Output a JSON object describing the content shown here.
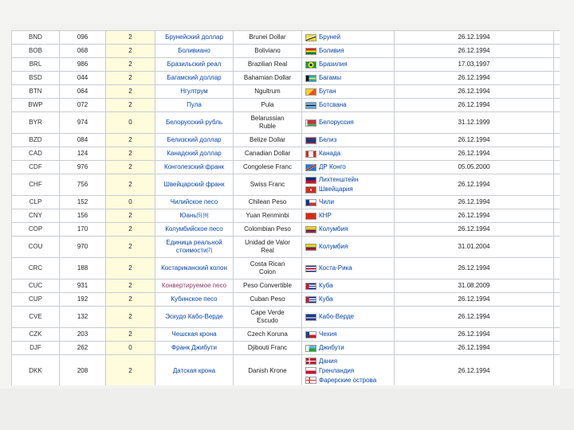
{
  "rows": [
    {
      "code": "BND",
      "num": "096",
      "digits": "2",
      "local": "Брунейский доллар",
      "eng": [
        "Brunei Dollar"
      ],
      "countries": [
        {
          "name": "Бруней",
          "flag": "bn"
        }
      ],
      "date": "26.12.1994"
    },
    {
      "code": "BOB",
      "num": "068",
      "digits": "2",
      "local": "Боливиано",
      "eng": [
        "Boliviano"
      ],
      "countries": [
        {
          "name": "Боливия",
          "flag": "bo"
        }
      ],
      "date": "26.12.1994"
    },
    {
      "code": "BRL",
      "num": "986",
      "digits": "2",
      "local": "Бразильский реал",
      "eng": [
        "Brazilian Real"
      ],
      "countries": [
        {
          "name": "Бразилия",
          "flag": "br"
        }
      ],
      "date": "17.03.1997"
    },
    {
      "code": "BSD",
      "num": "044",
      "digits": "2",
      "local": "Багамский доллар",
      "eng": [
        "Bahamian Dollar"
      ],
      "countries": [
        {
          "name": "Багамы",
          "flag": "bs"
        }
      ],
      "date": "26.12.1994"
    },
    {
      "code": "BTN",
      "num": "064",
      "digits": "2",
      "local": "Нгултрум",
      "eng": [
        "Ngultrum"
      ],
      "countries": [
        {
          "name": "Бутан",
          "flag": "bt"
        }
      ],
      "date": "26.12.1994"
    },
    {
      "code": "BWP",
      "num": "072",
      "digits": "2",
      "local": "Пула",
      "eng": [
        "Pula"
      ],
      "countries": [
        {
          "name": "Ботсвана",
          "flag": "bw"
        }
      ],
      "date": "26.12.1994"
    },
    {
      "code": "BYR",
      "num": "974",
      "digits": "0",
      "local": "Белорусский рубль",
      "eng": [
        "Belarussian",
        "Ruble"
      ],
      "countries": [
        {
          "name": "Белоруссия",
          "flag": "by"
        }
      ],
      "date": "31.12.1999",
      "h": "tall"
    },
    {
      "code": "BZD",
      "num": "084",
      "digits": "2",
      "local": "Белизский доллар",
      "eng": [
        "Belize Dollar"
      ],
      "countries": [
        {
          "name": "Белиз",
          "flag": "bz"
        }
      ],
      "date": "26.12.1994"
    },
    {
      "code": "CAD",
      "num": "124",
      "digits": "2",
      "local": "Канадский доллар",
      "eng": [
        "Canadian Dollar"
      ],
      "countries": [
        {
          "name": "Канада",
          "flag": "ca"
        }
      ],
      "date": "26.12.1994"
    },
    {
      "code": "CDF",
      "num": "976",
      "digits": "2",
      "local": "Конголезский франк",
      "eng": [
        "Congolese Franc"
      ],
      "countries": [
        {
          "name": "ДР Конго",
          "flag": "cd"
        }
      ],
      "date": "05.05.2000"
    },
    {
      "code": "CHF",
      "num": "756",
      "digits": "2",
      "local": "Швейцарский франк",
      "eng": [
        "Swiss Franc"
      ],
      "countries": [
        {
          "name": "Лихтенштейн",
          "flag": "li"
        },
        {
          "name": "Швейцария",
          "flag": "ch"
        }
      ],
      "date": "26.12.1994",
      "h": "tall"
    },
    {
      "code": "CLP",
      "num": "152",
      "digits": "0",
      "local": "Чилийское песо",
      "eng": [
        "Chilean Peso"
      ],
      "countries": [
        {
          "name": "Чили",
          "flag": "cl"
        }
      ],
      "date": "26.12.1994"
    },
    {
      "code": "CNY",
      "num": "156",
      "digits": "2",
      "local": "Юань",
      "sup": "[5] [6]",
      "eng": [
        "Yuan Renminbi"
      ],
      "countries": [
        {
          "name": "КНР",
          "flag": "cn"
        }
      ],
      "date": "26.12.1994"
    },
    {
      "code": "COP",
      "num": "170",
      "digits": "2",
      "local": "Колумбийское песо",
      "eng": [
        "Colombian Peso"
      ],
      "countries": [
        {
          "name": "Колумбия",
          "flag": "co"
        }
      ],
      "date": "26.12.1994"
    },
    {
      "code": "COU",
      "num": "970",
      "digits": "2",
      "local": "Единица реальной стоимости",
      "sup": "[7]",
      "eng": [
        "Unidad de Valor",
        "Real"
      ],
      "countries": [
        {
          "name": "Колумбия",
          "flag": "co"
        }
      ],
      "date": "31.01.2004",
      "h": "tall"
    },
    {
      "code": "CRC",
      "num": "188",
      "digits": "2",
      "local": "Костариканский колон",
      "eng": [
        "Costa Rican",
        "Colon"
      ],
      "countries": [
        {
          "name": "Коста-Рика",
          "flag": "cr"
        }
      ],
      "date": "26.12.1994",
      "h": "tall"
    },
    {
      "code": "CUC",
      "num": "931",
      "digits": "2",
      "local": "Конвертируемое песо",
      "visited": true,
      "eng": [
        "Peso Convertible"
      ],
      "countries": [
        {
          "name": "Куба",
          "flag": "cu"
        }
      ],
      "date": "31.08.2009"
    },
    {
      "code": "CUP",
      "num": "192",
      "digits": "2",
      "local": "Кубинское песо",
      "eng": [
        "Cuban Peso"
      ],
      "countries": [
        {
          "name": "Куба",
          "flag": "cu"
        }
      ],
      "date": "26.12.1994"
    },
    {
      "code": "CVE",
      "num": "132",
      "digits": "2",
      "local": "Эскудо Кабо-Верде",
      "eng": [
        "Cape Verde",
        "Escudo"
      ],
      "countries": [
        {
          "name": "Кабо-Верде",
          "flag": "cv"
        }
      ],
      "date": "26.12.1994",
      "h": "tall"
    },
    {
      "code": "CZK",
      "num": "203",
      "digits": "2",
      "local": "Чешская крона",
      "eng": [
        "Czech Koruna"
      ],
      "countries": [
        {
          "name": "Чехия",
          "flag": "cz"
        }
      ],
      "date": "26.12.1994"
    },
    {
      "code": "DJF",
      "num": "262",
      "digits": "0",
      "local": "Франк Джибути",
      "eng": [
        "Djibouti Franc"
      ],
      "countries": [
        {
          "name": "Джибути",
          "flag": "dj"
        }
      ],
      "date": "26.12.1994"
    },
    {
      "code": "DKK",
      "num": "208",
      "digits": "2",
      "local": "Датская крона",
      "eng": [
        "Danish Krone"
      ],
      "countries": [
        {
          "name": "Дания",
          "flag": "dk"
        },
        {
          "name": "Гренландия",
          "flag": "gl"
        },
        {
          "name": "Фарерские острова",
          "flag": "fo"
        }
      ],
      "date": "26.12.1994",
      "h": "tall3"
    }
  ]
}
